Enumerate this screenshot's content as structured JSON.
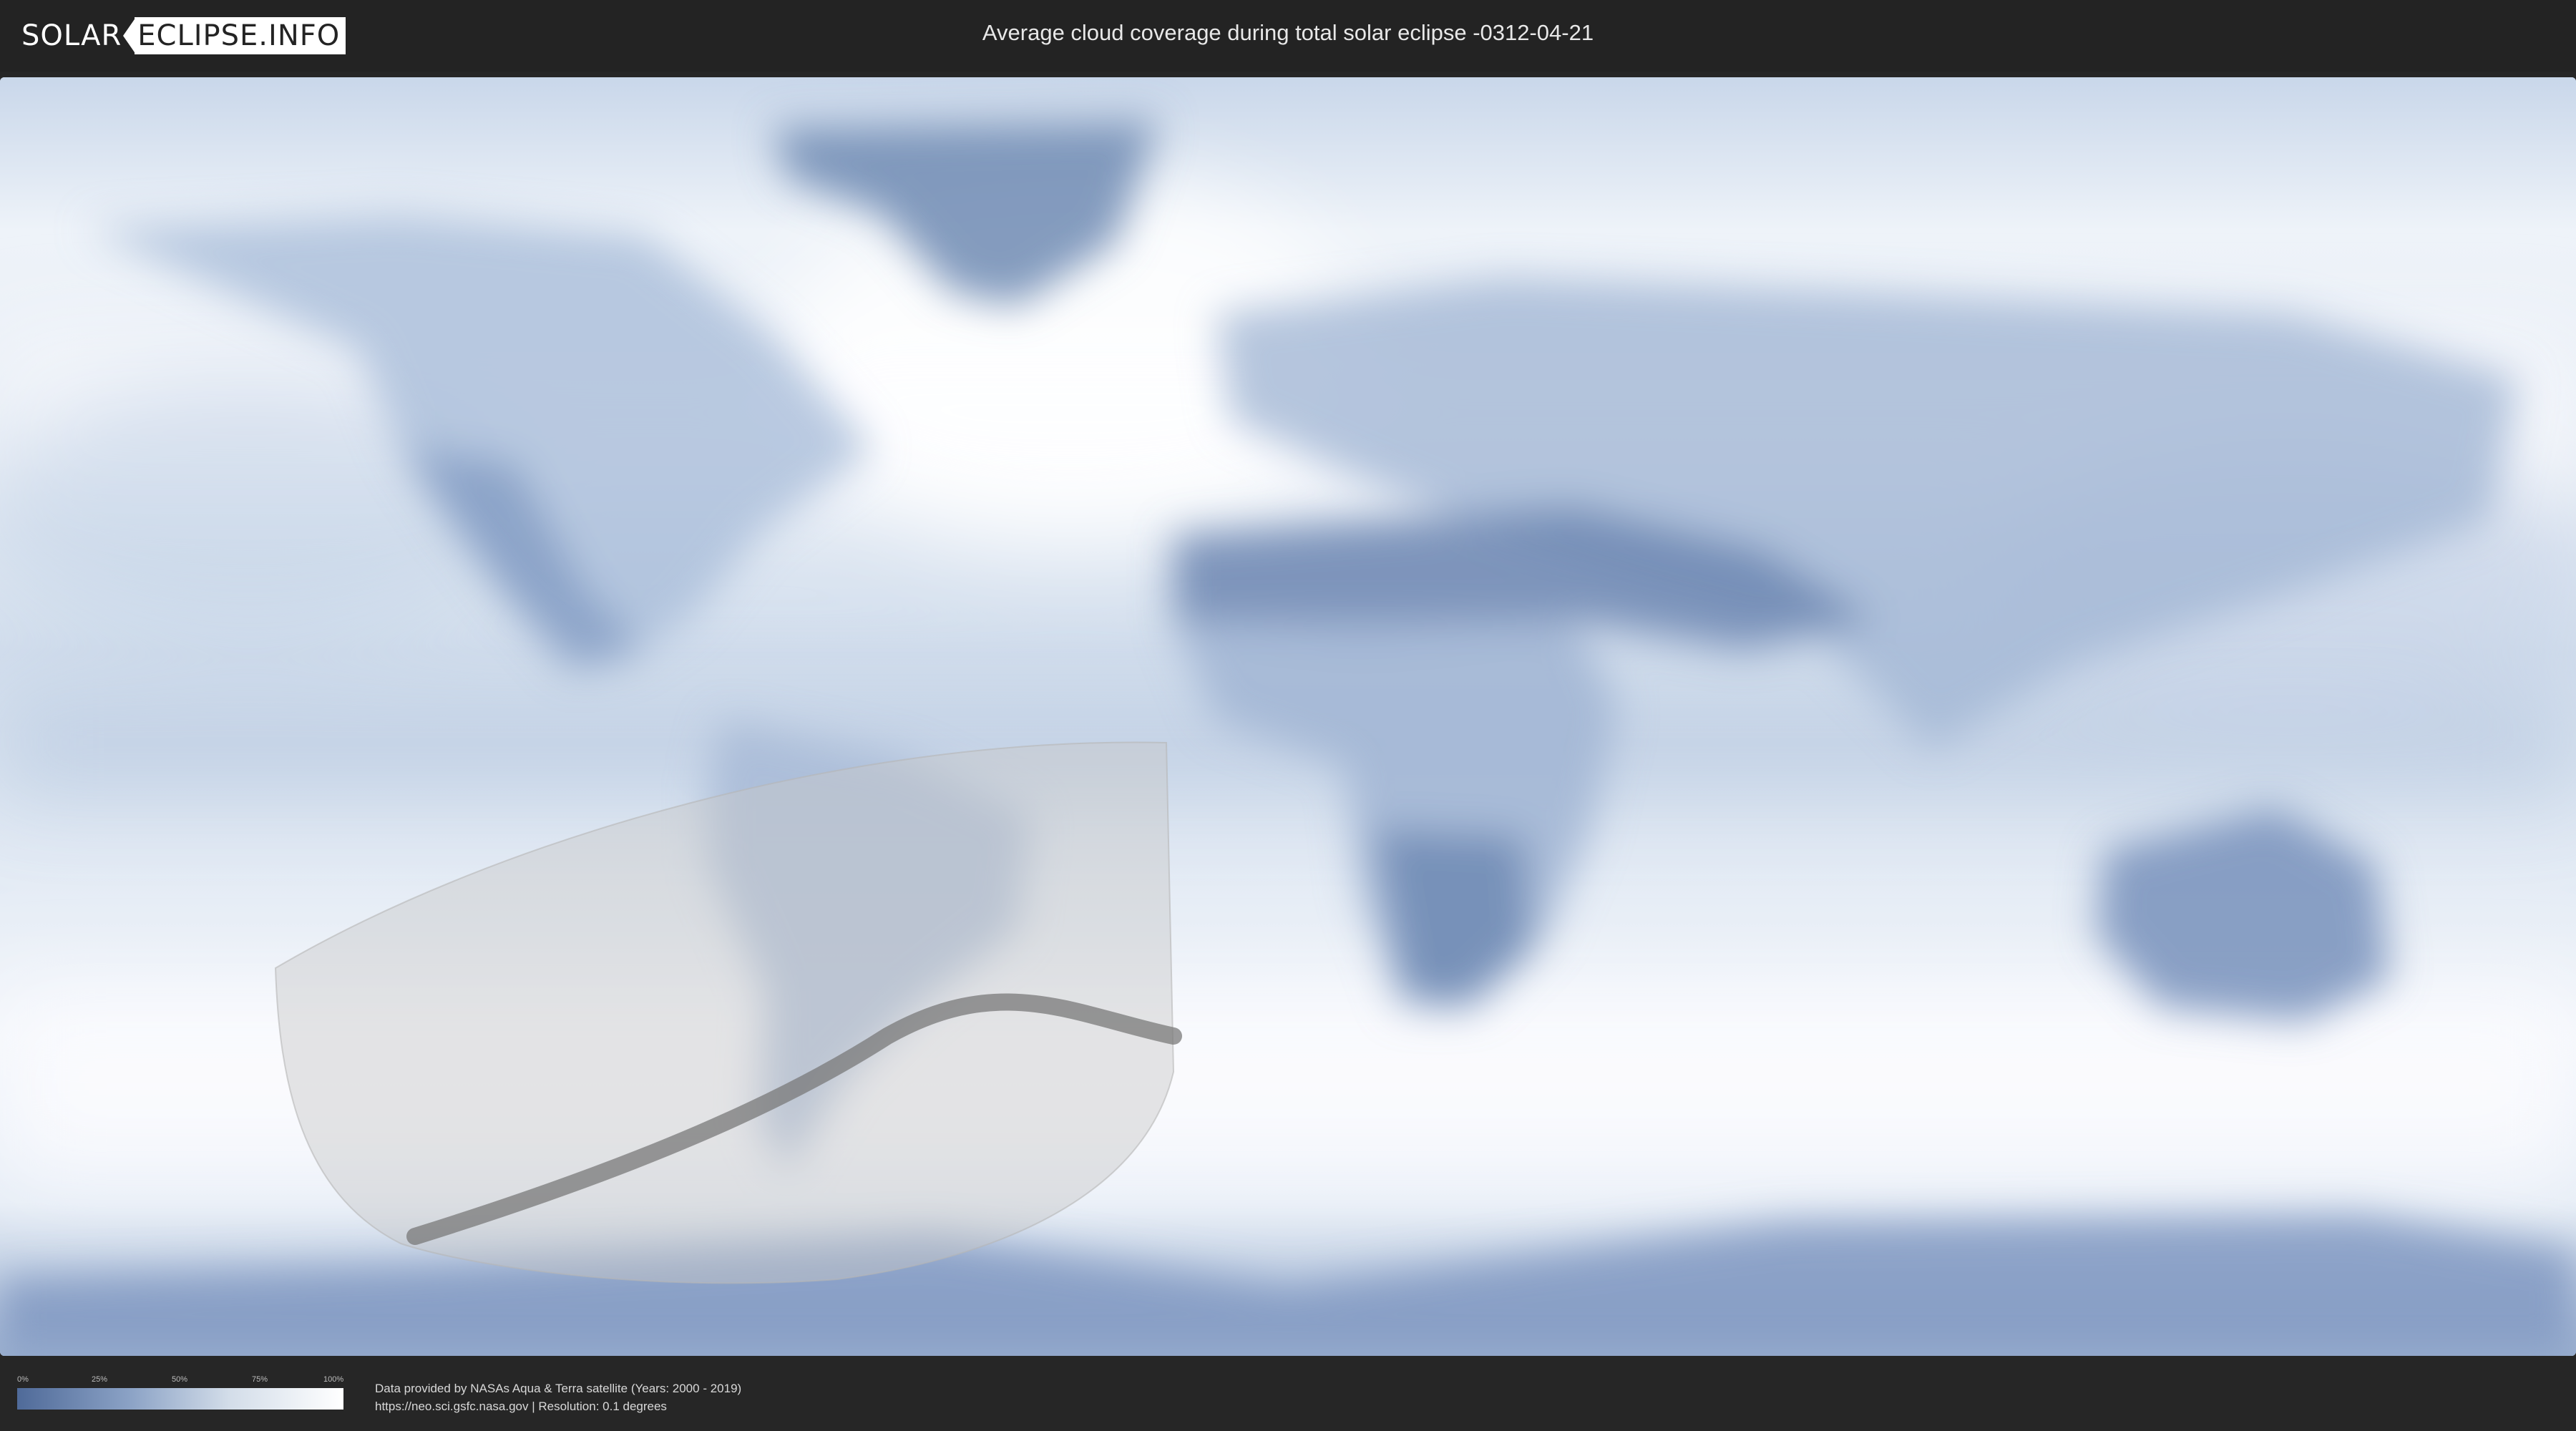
{
  "header": {
    "logo_solar": "SOLAR",
    "logo_eclipse": "ECLIPSE.INFO",
    "title": "Average cloud coverage during total solar eclipse -0312-04-21"
  },
  "map": {
    "layer": "average cloud coverage",
    "colors": {
      "clear_sky": "#4f6a99",
      "full_cloud": "#ffffff",
      "eclipse_visibility_zone": "#c8c8c8",
      "totality_path": "#7a7a7a"
    }
  },
  "legend": {
    "ticks": [
      "0%",
      "25%",
      "50%",
      "75%",
      "100%"
    ]
  },
  "footer": {
    "credit_line1": "Data provided by NASAs Aqua & Terra satellite (Years: 2000 - 2019)",
    "credit_line2": "https://neo.sci.gsfc.nasa.gov | Resolution: 0.1 degrees"
  }
}
